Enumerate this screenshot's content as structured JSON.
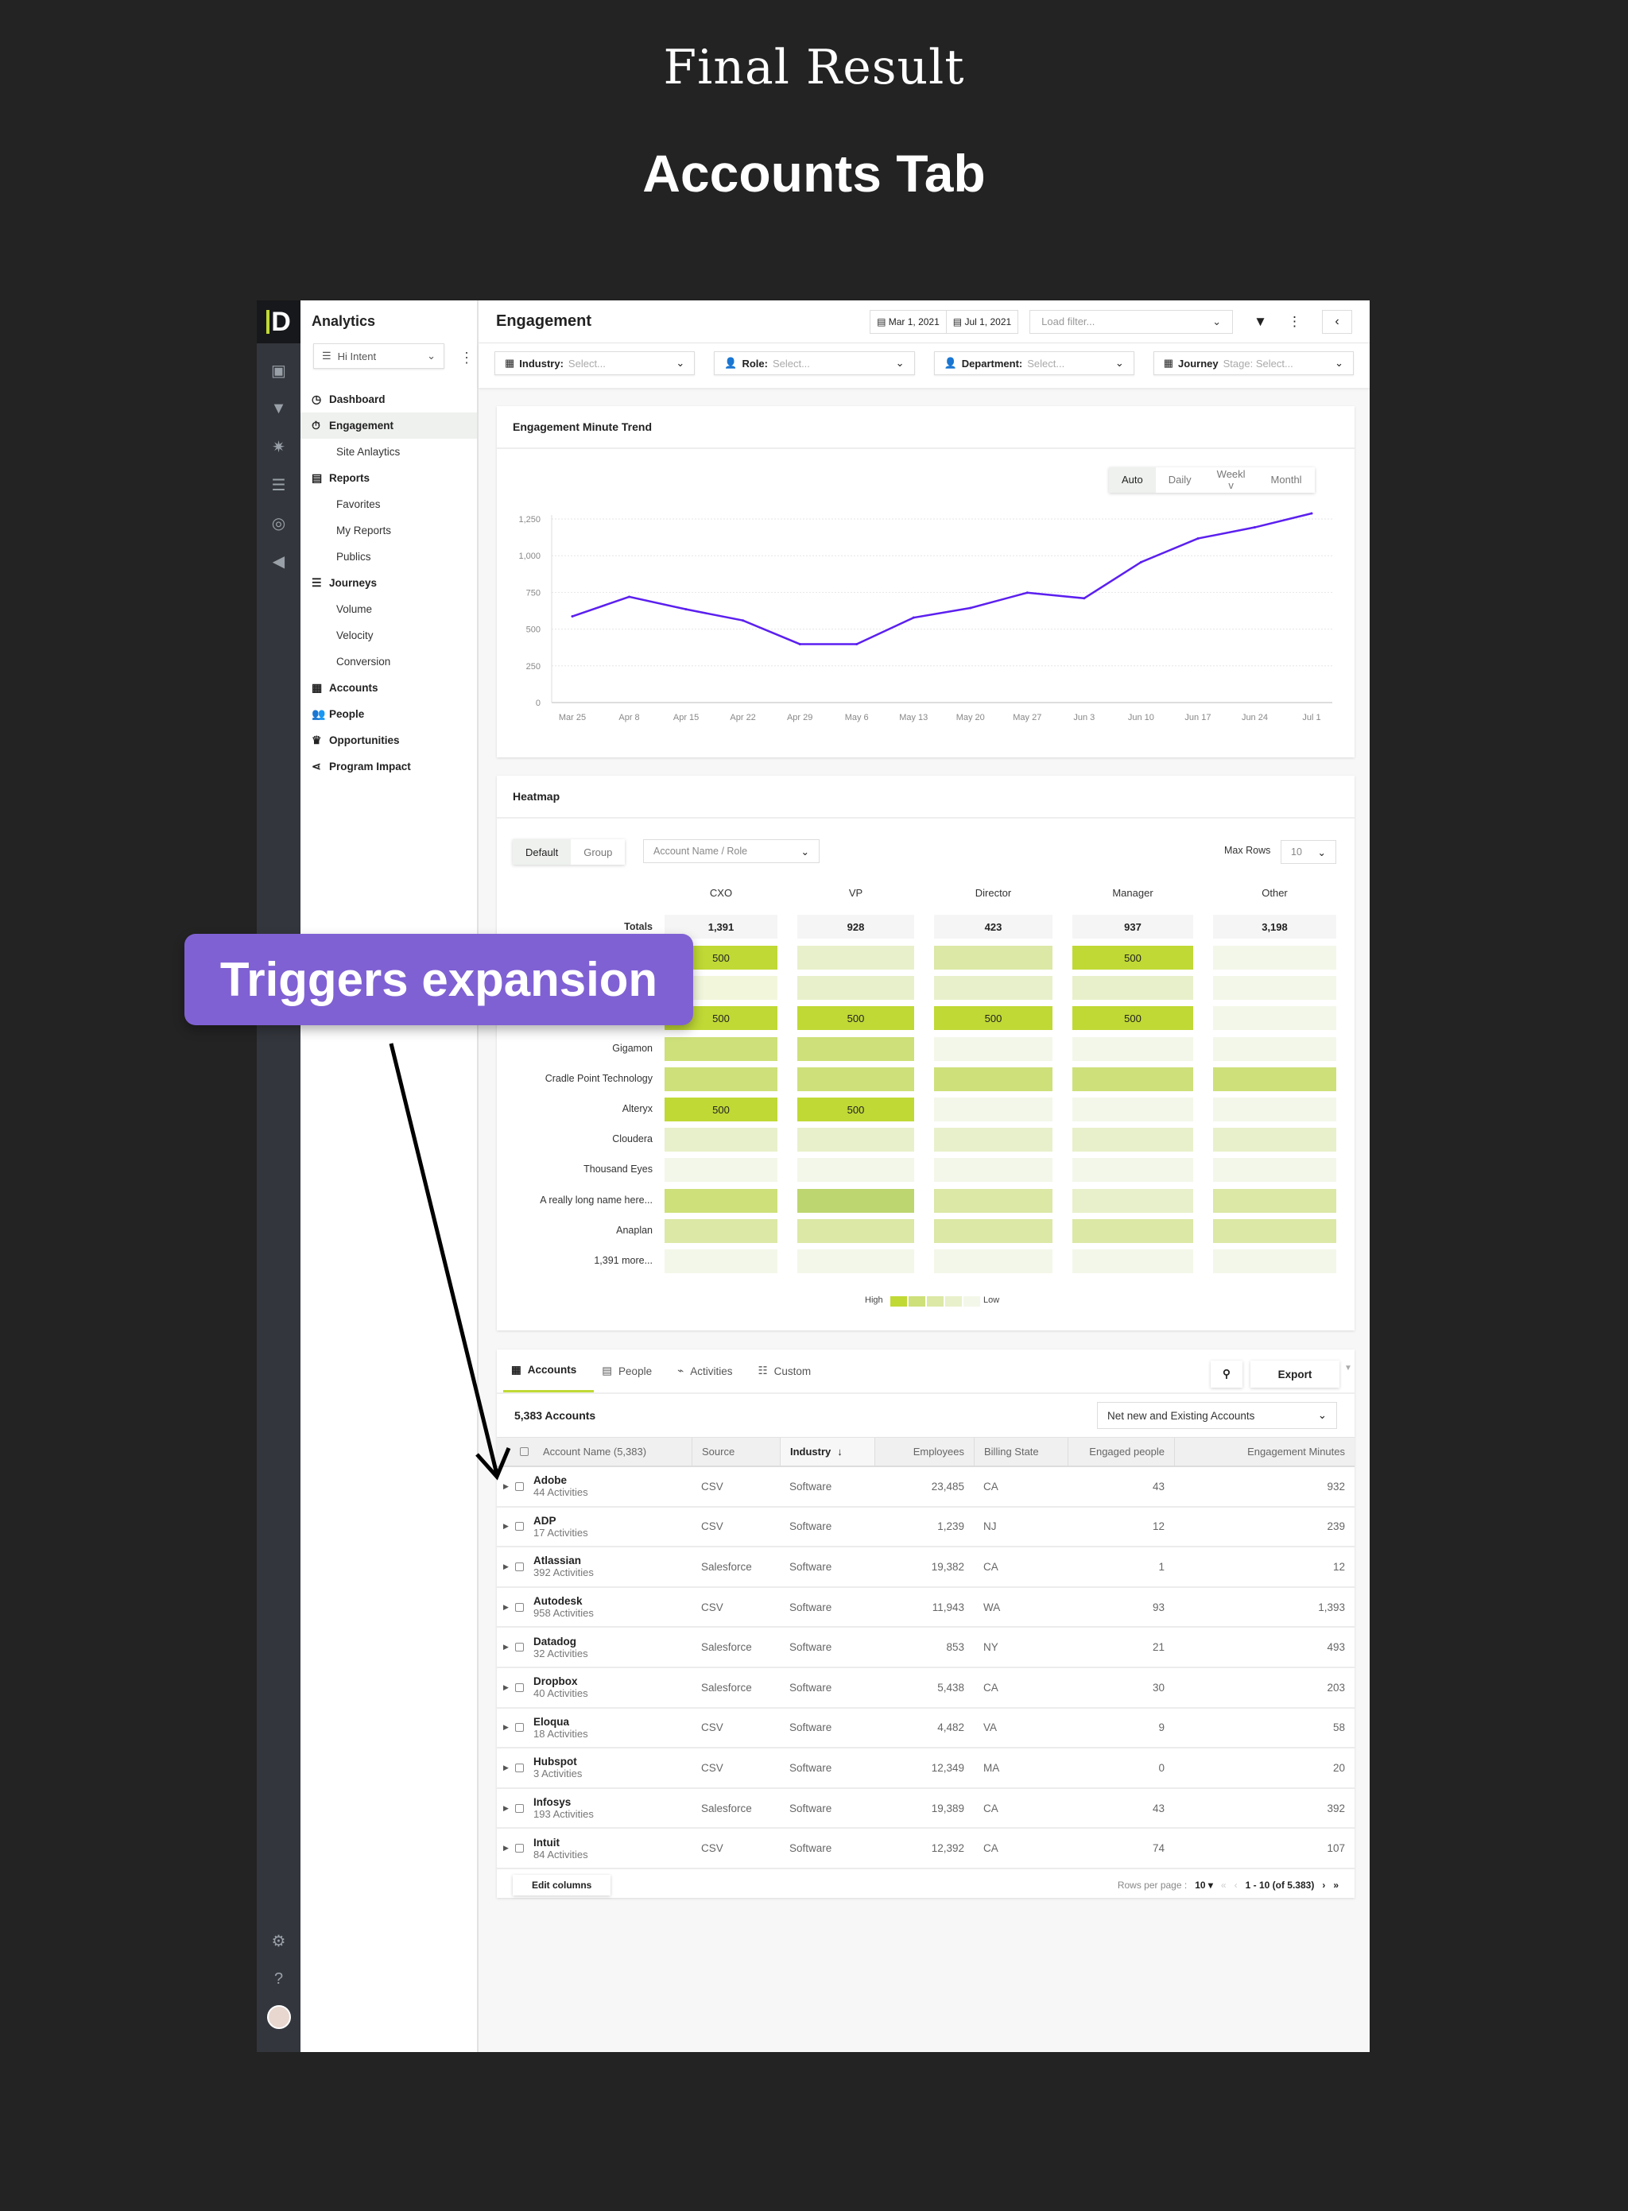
{
  "hero": {
    "title": "Final Result",
    "subtitle": "Accounts Tab"
  },
  "callout": "Triggers expansion",
  "rail": {
    "icons": [
      "accounts-icon",
      "funnel-icon",
      "magic-icon",
      "database-icon",
      "target-icon",
      "megaphone-icon"
    ],
    "bottom": [
      "settings-icon",
      "help-icon",
      "avatar"
    ]
  },
  "sidebar": {
    "title": "Analytics",
    "selector": "Hi Intent",
    "items": [
      {
        "label": "Dashboard",
        "icon": "gauge-icon",
        "type": "main"
      },
      {
        "label": "Engagement",
        "icon": "stopwatch-icon",
        "type": "main",
        "active": true
      },
      {
        "label": "Site Anlaytics",
        "type": "sub"
      },
      {
        "label": "Reports",
        "icon": "report-icon",
        "type": "main"
      },
      {
        "label": "Favorites",
        "type": "sub"
      },
      {
        "label": "My Reports",
        "type": "sub"
      },
      {
        "label": "Publics",
        "type": "sub"
      },
      {
        "label": "Journeys",
        "icon": "journey-icon",
        "type": "main"
      },
      {
        "label": "Volume",
        "type": "sub"
      },
      {
        "label": "Velocity",
        "type": "sub"
      },
      {
        "label": "Conversion",
        "type": "sub"
      },
      {
        "label": "Accounts",
        "icon": "building-icon",
        "type": "main"
      },
      {
        "label": "People",
        "icon": "people-icon",
        "type": "main"
      },
      {
        "label": "Opportunities",
        "icon": "crown-icon",
        "type": "main"
      },
      {
        "label": "Program Impact",
        "icon": "share-icon",
        "type": "main"
      }
    ]
  },
  "header": {
    "title": "Engagement",
    "date_start": "Mar 1, 2021",
    "date_end": "Jul 1, 2021",
    "load_filter_placeholder": "Load filter..."
  },
  "filters": [
    {
      "label": "Industry:",
      "placeholder": "Select...",
      "icon": "building-icon"
    },
    {
      "label": "Role:",
      "placeholder": "Select...",
      "icon": "person-icon"
    },
    {
      "label": "Department:",
      "placeholder": "Select...",
      "icon": "person-icon"
    },
    {
      "label": "Journey",
      "placeholder": "Stage: Select...",
      "icon": "building-icon"
    }
  ],
  "trend": {
    "title": "Engagement Minute Trend",
    "granularity": [
      "Auto",
      "Daily",
      "Weekly",
      "Monthly"
    ],
    "granularity_shown": [
      "Auto",
      "Daily",
      "Weekl\nv",
      "Monthl"
    ],
    "selected": "Auto"
  },
  "chart_data": {
    "type": "line",
    "title": "Engagement Minute Trend",
    "x": [
      "Mar 25",
      "Apr 8",
      "Apr 15",
      "Apr 22",
      "Apr 29",
      "May 6",
      "May 13",
      "May 20",
      "May 27",
      "Jun 3",
      "Jun 10",
      "Jun 17",
      "Jun 24",
      "Jul 1"
    ],
    "values": [
      587,
      720,
      635,
      559,
      398,
      398,
      578,
      644,
      748,
      710,
      956,
      1117,
      1193,
      1288
    ],
    "yticks": [
      0,
      250,
      500,
      750,
      1000,
      1250
    ],
    "ytick_labels": [
      "0",
      "250",
      "500",
      "750",
      "1,000",
      "1,250"
    ],
    "ylim": [
      0,
      1300
    ],
    "grid": true,
    "color": "#5b1ff0"
  },
  "heatmap": {
    "title": "Heatmap",
    "modes": [
      "Default",
      "Group"
    ],
    "selected_mode": "Default",
    "dimension": "Account Name / Role",
    "max_rows_label": "Max Rows",
    "max_rows": "10",
    "columns": [
      "CXO",
      "VP",
      "Director",
      "Manager",
      "Other"
    ],
    "totals_label": "Totals",
    "totals": [
      "1,391",
      "928",
      "423",
      "937",
      "3,198"
    ],
    "rows": [
      {
        "label": "",
        "levels": [
          5,
          2,
          3,
          5,
          1
        ],
        "values": [
          "500",
          "",
          "",
          "500",
          ""
        ]
      },
      {
        "label": "",
        "levels": [
          0,
          2,
          2,
          2,
          1
        ],
        "values": [
          "",
          "",
          "",
          "",
          ""
        ]
      },
      {
        "label": "",
        "levels": [
          5,
          5,
          5,
          5,
          1
        ],
        "values": [
          "500",
          "500",
          "500",
          "500",
          ""
        ]
      },
      {
        "label": "Gigamon",
        "levels": [
          4,
          4,
          1,
          1,
          1
        ],
        "values": [
          "",
          "",
          "",
          "",
          ""
        ]
      },
      {
        "label": "Cradle Point Technology",
        "levels": [
          4,
          4,
          4,
          4,
          4
        ],
        "values": [
          "",
          "",
          "",
          "",
          ""
        ]
      },
      {
        "label": "Alteryx",
        "levels": [
          5,
          5,
          1,
          1,
          1
        ],
        "values": [
          "500",
          "500",
          "",
          "",
          ""
        ]
      },
      {
        "label": "Cloudera",
        "levels": [
          2,
          2,
          2,
          2,
          2
        ],
        "values": [
          "",
          "",
          "",
          "",
          ""
        ]
      },
      {
        "label": "Thousand Eyes",
        "levels": [
          1,
          1,
          1,
          1,
          1
        ],
        "values": [
          "",
          "",
          "",
          "",
          ""
        ]
      },
      {
        "label": "A really long name here...",
        "levels": [
          4,
          6,
          3,
          2,
          3
        ],
        "values": [
          "",
          "",
          "",
          "",
          ""
        ]
      },
      {
        "label": "Anaplan",
        "levels": [
          3,
          3,
          3,
          3,
          3
        ],
        "values": [
          "",
          "",
          "",
          "",
          ""
        ]
      },
      {
        "label": "1,391 more...",
        "levels": [
          1,
          1,
          1,
          1,
          1
        ],
        "values": [
          "",
          "",
          "",
          "",
          ""
        ]
      }
    ],
    "legend": {
      "high": "High",
      "low": "Low"
    },
    "colors": {
      "0": "#f2f7dc",
      "1": "#f3f7e9",
      "2": "#e8f0cb",
      "3": "#dbe8a6",
      "4": "#cde07a",
      "5": "#c0d935",
      "6": "#bdd670"
    }
  },
  "table": {
    "tabs": [
      {
        "label": "Accounts",
        "icon": "building-icon"
      },
      {
        "label": "People",
        "icon": "contact-icon"
      },
      {
        "label": "Activities",
        "icon": "pulse-icon"
      },
      {
        "label": "Custom",
        "icon": "sliders-icon"
      }
    ],
    "export": "Export",
    "count": "5,383 Accounts",
    "scope": "Net new and Existing Accounts",
    "columns": [
      "Account Name (5,383)",
      "Source",
      "Industry",
      "Employees",
      "Billing State",
      "Engaged people",
      "Engagement Minutes"
    ],
    "sort_column": "Industry",
    "rows": [
      [
        "Adobe",
        "44 Activities",
        "CSV",
        "Software",
        "23,485",
        "CA",
        "43",
        "932"
      ],
      [
        "ADP",
        "17 Activities",
        "CSV",
        "Software",
        "1,239",
        "NJ",
        "12",
        "239"
      ],
      [
        "Atlassian",
        "392 Activities",
        "Salesforce",
        "Software",
        "19,382",
        "CA",
        "1",
        "12"
      ],
      [
        "Autodesk",
        "958 Activities",
        "CSV",
        "Software",
        "11,943",
        "WA",
        "93",
        "1,393"
      ],
      [
        "Datadog",
        "32 Activities",
        "Salesforce",
        "Software",
        "853",
        "NY",
        "21",
        "493"
      ],
      [
        "Dropbox",
        "40 Activities",
        "Salesforce",
        "Software",
        "5,438",
        "CA",
        "30",
        "203"
      ],
      [
        "Eloqua",
        "18 Activities",
        "CSV",
        "Software",
        "4,482",
        "VA",
        "9",
        "58"
      ],
      [
        "Hubspot",
        "3 Activities",
        "CSV",
        "Software",
        "12,349",
        "MA",
        "0",
        "20"
      ],
      [
        "Infosys",
        "193 Activities",
        "Salesforce",
        "Software",
        "19,389",
        "CA",
        "43",
        "392"
      ],
      [
        "Intuit",
        "84 Activities",
        "CSV",
        "Software",
        "12,392",
        "CA",
        "74",
        "107"
      ]
    ],
    "edit_columns": "Edit columns",
    "rows_per_page_label": "Rows per page :",
    "rows_per_page": "10",
    "page_range": "1 - 10 (of 5.383)"
  }
}
